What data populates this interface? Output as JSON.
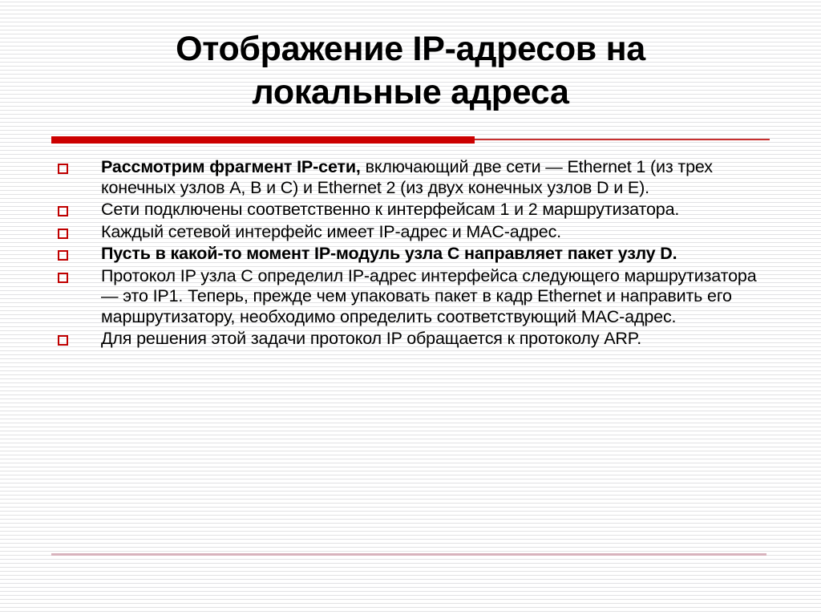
{
  "slide": {
    "title_lines": [
      "Отображение IP-адресов на",
      "локальные адреса"
    ],
    "accent_color": "#cc0000",
    "bullet_marker_color": "#c00000",
    "text_color": "#000000",
    "bullets": [
      {
        "lead_bold": "Рассмотрим фрагмент IP-сети,",
        "text": " включающий две сети — Ethernet 1 (из трех конечных узлов A, B и C) и Ethernet 2 (из двух конечных узлов D и E).",
        "bold": false
      },
      {
        "lead_bold": "",
        "text": "Сети подключены соответственно к интерфейсам 1 и 2 маршрутизатора.",
        "bold": false
      },
      {
        "lead_bold": "",
        "text": "Каждый сетевой интерфейс имеет IP-адрес и MAC-адрес.",
        "bold": false
      },
      {
        "lead_bold": "",
        "text": "Пусть в какой-то момент IP-модуль узла C направляет пакет узлу D.",
        "bold": true
      },
      {
        "lead_bold": "",
        "text": "Протокол IP узла C определил IP-адрес интерфейса следующего маршрутизатора — это IP1. Теперь, прежде чем упаковать пакет в кадр Ethernet и направить его маршрутизатору, необходимо определить соответствующий MAC-адрес.",
        "bold": false
      },
      {
        "lead_bold": "",
        "text": "Для решения этой задачи протокол IP обращается к протоколу ARP.",
        "bold": false
      }
    ]
  }
}
